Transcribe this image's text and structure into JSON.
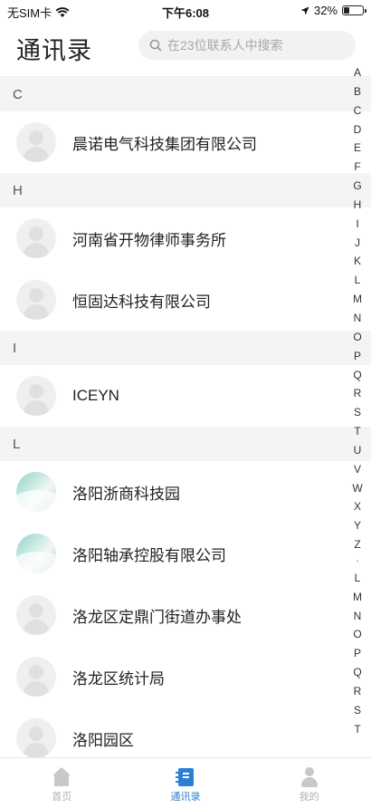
{
  "status_bar": {
    "carrier": "无SIM卡",
    "time": "下午6:08",
    "battery": "32%",
    "battery_level": 0.32
  },
  "header": {
    "title": "通讯录",
    "search_placeholder": "在23位联系人中搜索"
  },
  "sections": [
    {
      "letter": "C",
      "contacts": [
        {
          "name": "晨诺电气科技集团有限公司",
          "avatar": "default"
        }
      ]
    },
    {
      "letter": "H",
      "contacts": [
        {
          "name": "河南省开物律师事务所",
          "avatar": "default"
        },
        {
          "name": "恒固达科技有限公司",
          "avatar": "default"
        }
      ]
    },
    {
      "letter": "I",
      "contacts": [
        {
          "name": "ICEYN",
          "avatar": "default"
        }
      ]
    },
    {
      "letter": "L",
      "contacts": [
        {
          "name": "洛阳浙商科技园",
          "avatar": "photo"
        },
        {
          "name": "洛阳轴承控股有限公司",
          "avatar": "photo"
        },
        {
          "name": "洛龙区定鼎门街道办事处",
          "avatar": "default"
        },
        {
          "name": "洛龙区统计局",
          "avatar": "default"
        },
        {
          "name": "洛阳园区",
          "avatar": "default"
        }
      ]
    }
  ],
  "index_letters_top": [
    "A",
    "B",
    "C",
    "D",
    "E",
    "F",
    "G",
    "H",
    "I",
    "J",
    "K",
    "L",
    "M",
    "N",
    "O",
    "P",
    "Q",
    "R",
    "S",
    "T",
    "U",
    "V",
    "W",
    "X",
    "Y",
    "Z"
  ],
  "index_letters_bottom": [
    "L",
    "M",
    "N",
    "O",
    "P",
    "Q",
    "R",
    "S",
    "T"
  ],
  "tabs": [
    {
      "label": "首页",
      "icon": "home-icon",
      "active": false
    },
    {
      "label": "通讯录",
      "icon": "contacts-book-icon",
      "active": true
    },
    {
      "label": "我的",
      "icon": "user-icon",
      "active": false
    }
  ],
  "colors": {
    "accent": "#2a7fd6",
    "section_bg": "#f4f4f4",
    "inactive": "#b0b0b0"
  }
}
